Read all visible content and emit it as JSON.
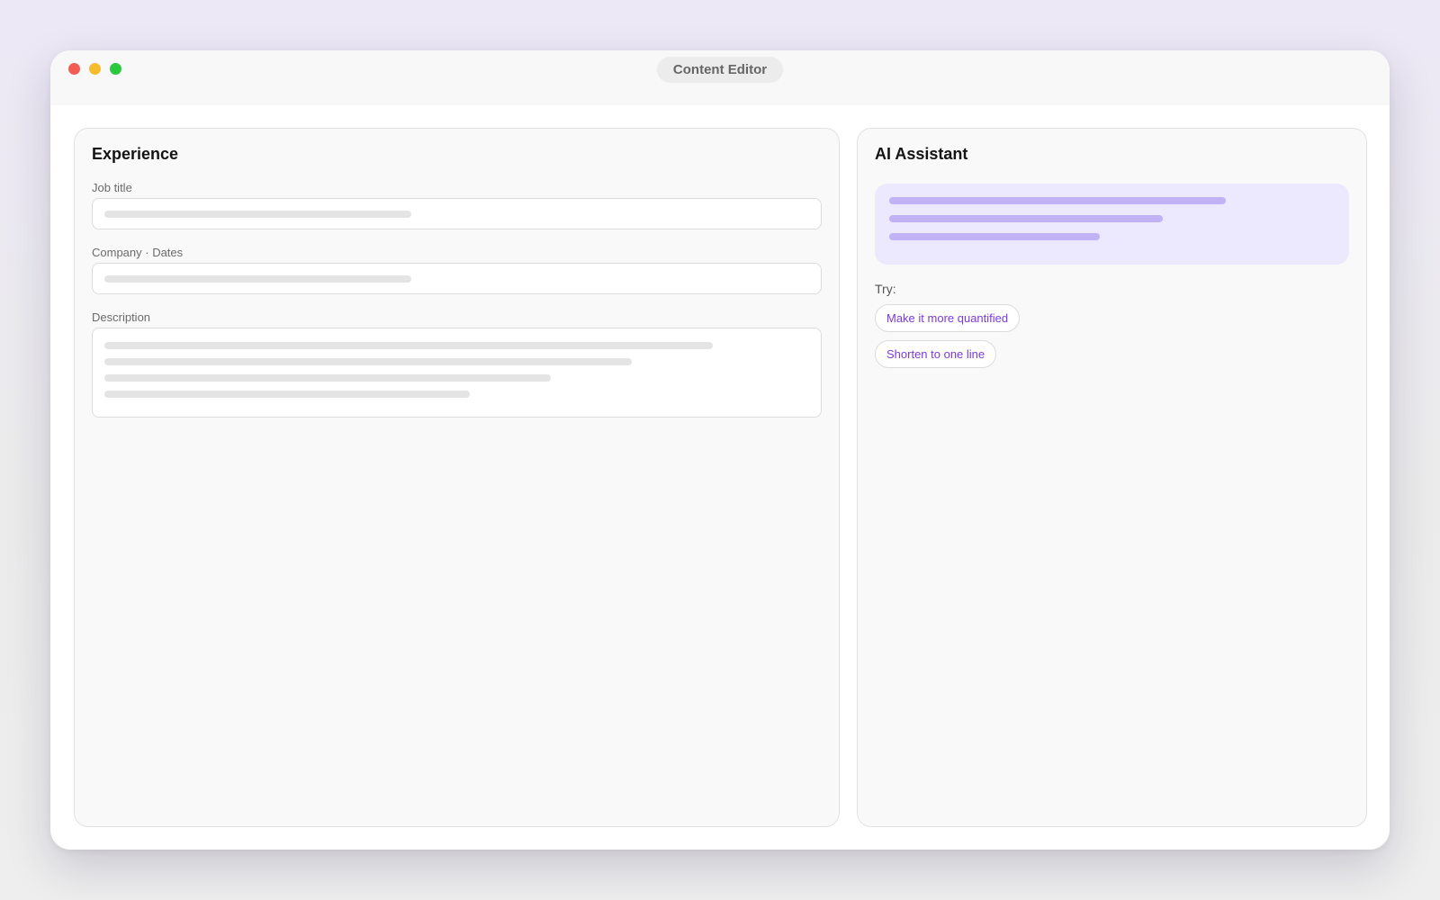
{
  "window": {
    "title": "Content Editor"
  },
  "editor": {
    "heading": "Experience",
    "fields": {
      "job_title_label": "Job title",
      "company_dates_label": "Company · Dates",
      "description_label": "Description"
    }
  },
  "assistant": {
    "heading": "AI Assistant",
    "try_label": "Try:",
    "suggestions": [
      "Make it more quantified",
      "Shorten to one line"
    ]
  },
  "colors": {
    "accent": "#7c3ad9",
    "bubble_bg": "#ece8fd",
    "bubble_line": "#c1b1f5",
    "close": "#f25c54",
    "minimize": "#f5bd2e",
    "maximize": "#2bc840"
  }
}
